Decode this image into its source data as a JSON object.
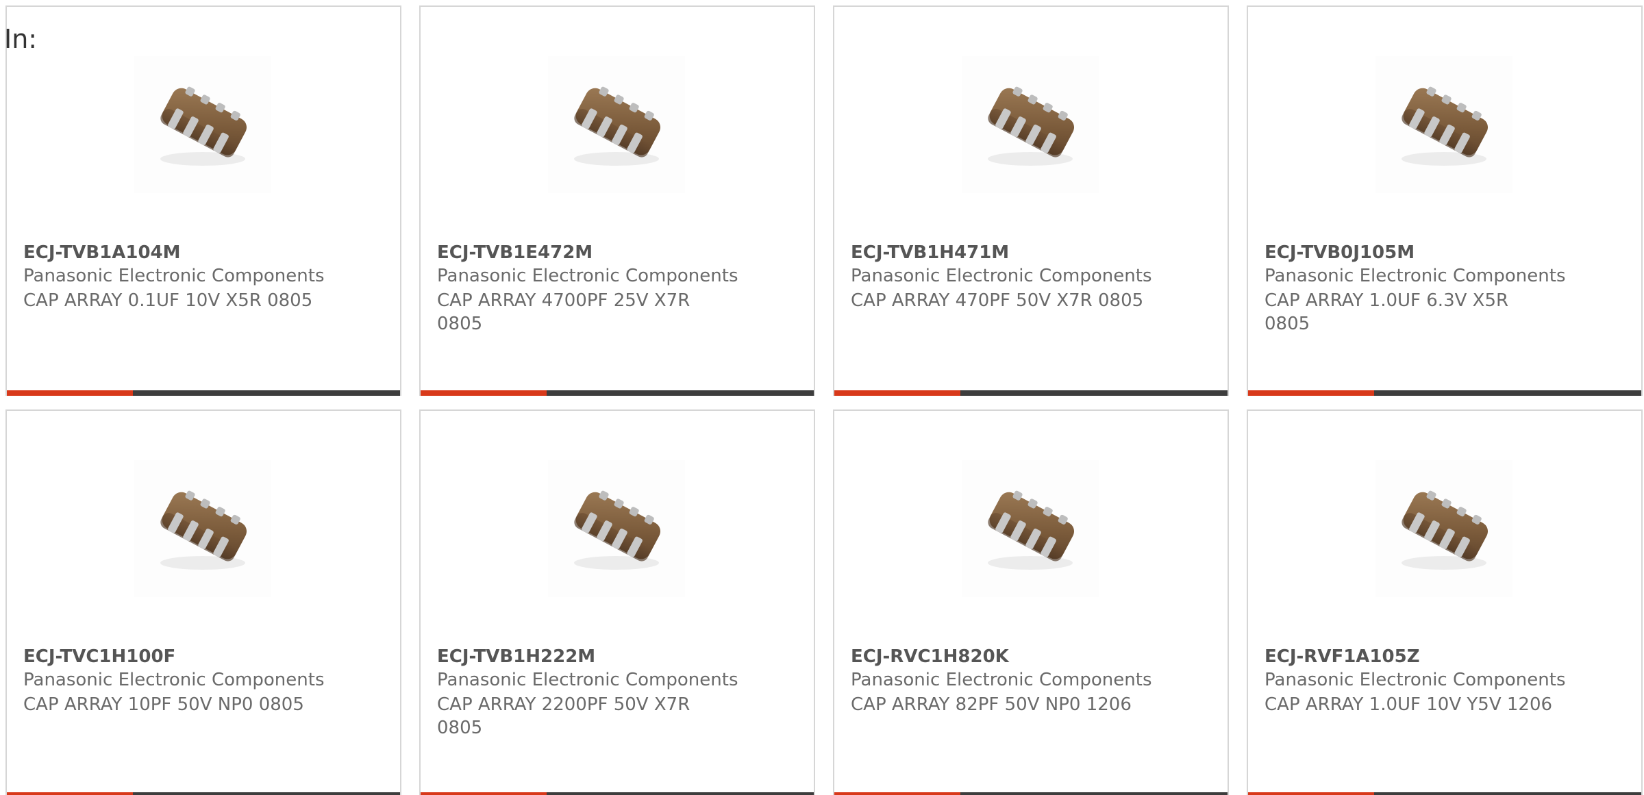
{
  "header": {
    "label": "In:"
  },
  "colors": {
    "card_border": "#d6d6d6",
    "title_text": "#555555",
    "body_text": "#6a6a6a",
    "bar_accent": "#d8391a",
    "bar_track": "#3d3d3d"
  },
  "products": [
    {
      "part_number": "ECJ-TVB1A104M",
      "manufacturer": "Panasonic Electronic Components",
      "description": "CAP ARRAY 0.1UF 10V X5R 0805",
      "image_icon": "capacitor-array-chip-icon",
      "bar_fill": 0.32
    },
    {
      "part_number": "ECJ-TVB1E472M",
      "manufacturer": "Panasonic Electronic Components",
      "description": "CAP ARRAY 4700PF 25V X7R 0805",
      "image_icon": "capacitor-array-chip-icon",
      "bar_fill": 0.32
    },
    {
      "part_number": "ECJ-TVB1H471M",
      "manufacturer": "Panasonic Electronic Components",
      "description": "CAP ARRAY 470PF 50V X7R 0805",
      "image_icon": "capacitor-array-chip-icon",
      "bar_fill": 0.32
    },
    {
      "part_number": "ECJ-TVB0J105M",
      "manufacturer": "Panasonic Electronic Components",
      "description": "CAP ARRAY 1.0UF 6.3V X5R 0805",
      "image_icon": "capacitor-array-chip-icon",
      "bar_fill": 0.32
    },
    {
      "part_number": "ECJ-TVC1H100F",
      "manufacturer": "Panasonic Electronic Components",
      "description": "CAP ARRAY 10PF 50V NP0 0805",
      "image_icon": "capacitor-array-chip-icon",
      "bar_fill": 0.32
    },
    {
      "part_number": "ECJ-TVB1H222M",
      "manufacturer": "Panasonic Electronic Components",
      "description": "CAP ARRAY 2200PF 50V X7R 0805",
      "image_icon": "capacitor-array-chip-icon",
      "bar_fill": 0.32
    },
    {
      "part_number": "ECJ-RVC1H820K",
      "manufacturer": "Panasonic Electronic Components",
      "description": "CAP ARRAY 82PF 50V NP0 1206",
      "image_icon": "capacitor-array-chip-icon",
      "bar_fill": 0.32
    },
    {
      "part_number": "ECJ-RVF1A105Z",
      "manufacturer": "Panasonic Electronic Components",
      "description": "CAP ARRAY 1.0UF 10V Y5V 1206",
      "image_icon": "capacitor-array-chip-icon",
      "bar_fill": 0.32
    }
  ]
}
